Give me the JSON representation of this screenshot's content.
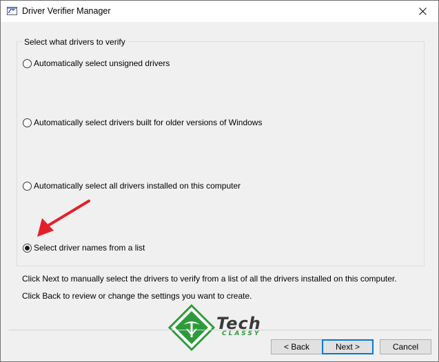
{
  "window": {
    "title": "Driver Verifier Manager"
  },
  "group": {
    "legend": "Select what drivers to verify",
    "options": [
      {
        "label": "Automatically select unsigned drivers",
        "checked": false
      },
      {
        "label": "Automatically select drivers built for older versions of Windows",
        "checked": false
      },
      {
        "label": "Automatically select all drivers installed on this computer",
        "checked": false
      },
      {
        "label": "Select driver names from a list",
        "checked": true
      }
    ]
  },
  "info": {
    "line1": "Click Next to manually select the drivers to verify from a list of all the drivers installed on this computer.",
    "line2": "Click Back to review or change the settings you want to create."
  },
  "buttons": {
    "back": "< Back",
    "next": "Next >",
    "cancel": "Cancel"
  },
  "watermark": {
    "word1": "Tech",
    "word2": "CLASSY"
  },
  "colors": {
    "annotation_arrow": "#e3202a",
    "accent": "#0078d7",
    "brand_green": "#2e9a3c"
  }
}
